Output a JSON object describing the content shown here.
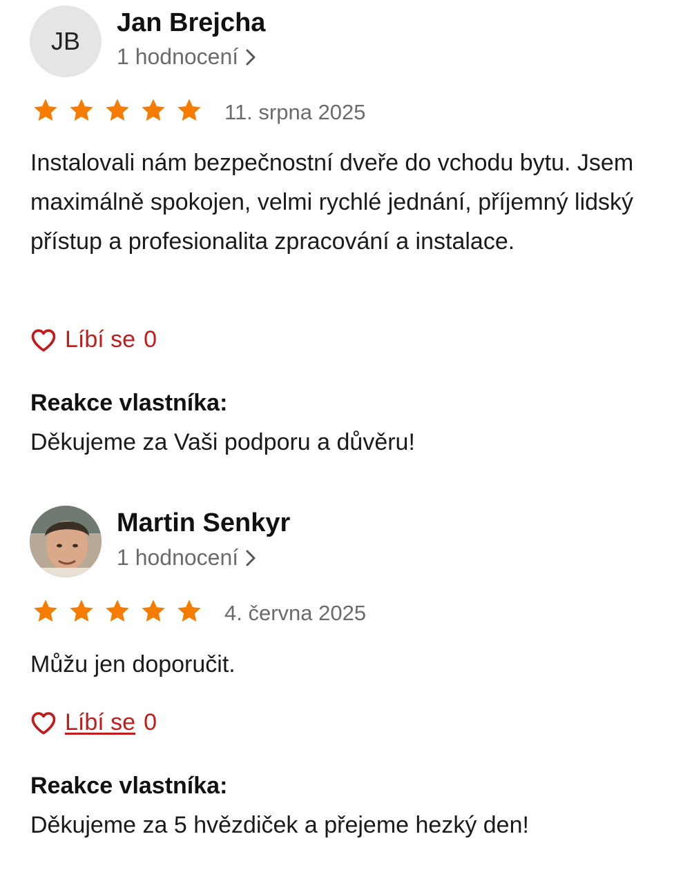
{
  "reviews": [
    {
      "author_initials": "JB",
      "author_name": "Jan Brejcha",
      "ratings_count": "1 hodnocení",
      "stars": 5,
      "date": "11. srpna 2025",
      "text": "Instalovali nám bezpečnostní dveře do vchodu bytu. Jsem maximálně spokojen, velmi rychlé jednání, příjemný lidský přístup a profesionalita zpracování a instalace.",
      "like_label": "Líbí se",
      "like_count": "0",
      "owner_reply_heading": "Reakce vlastníka:",
      "owner_reply": "Děkujeme za Vaši podporu a důvěru!"
    },
    {
      "author_initials": "",
      "author_name": "Martin Senkyr",
      "ratings_count": "1 hodnocení",
      "stars": 5,
      "date": "4. června 2025",
      "text": "Můžu jen doporučit.",
      "like_label": "Líbí se",
      "like_count": "0",
      "owner_reply_heading": "Reakce vlastníka:",
      "owner_reply": "Děkujeme za 5 hvězdiček a přejeme hezký den!"
    }
  ],
  "colors": {
    "star": "#f57c00",
    "like": "#c11b1b",
    "muted": "#6b6b6b"
  }
}
